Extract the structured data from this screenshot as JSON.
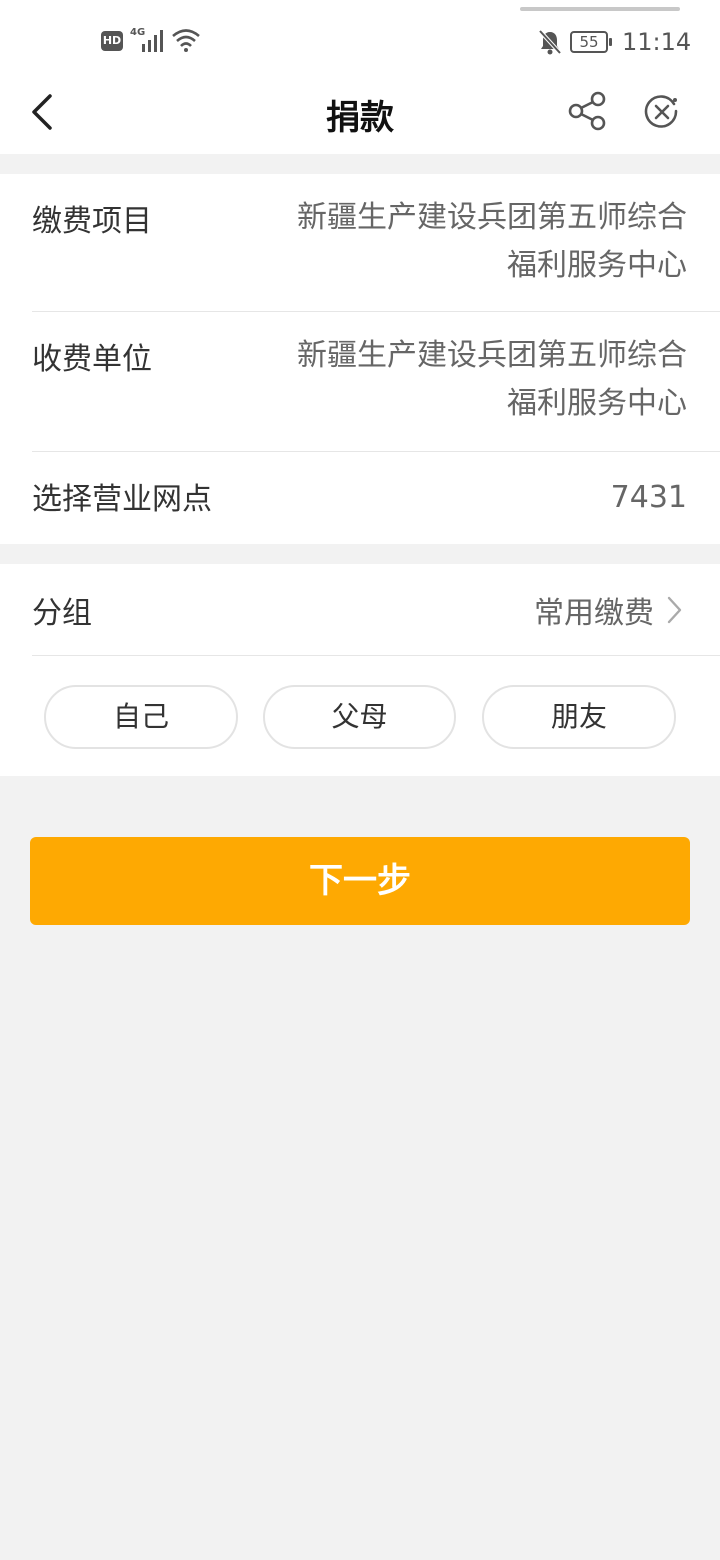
{
  "status_bar": {
    "hd": "HD",
    "network": "4G",
    "battery": "55",
    "time": "11:14"
  },
  "header": {
    "title": "捐款",
    "back_icon": "chevron-left-icon",
    "share_icon": "share-icon",
    "close_icon": "close-circle-icon"
  },
  "payment_info": {
    "item_label": "缴费项目",
    "item_value_line1": "新疆生产建设兵团第五师综合",
    "item_value_line2": "福利服务中心",
    "payee_label": "收费单位",
    "payee_value_line1": "新疆生产建设兵团第五师综合",
    "payee_value_line2": "福利服务中心",
    "branch_label": "选择营业网点",
    "branch_value": "7431"
  },
  "group": {
    "label": "分组",
    "value": "常用缴费",
    "options": [
      "自己",
      "父母",
      "朋友"
    ]
  },
  "next_button": {
    "label": "下一步",
    "color": "#fea902"
  }
}
